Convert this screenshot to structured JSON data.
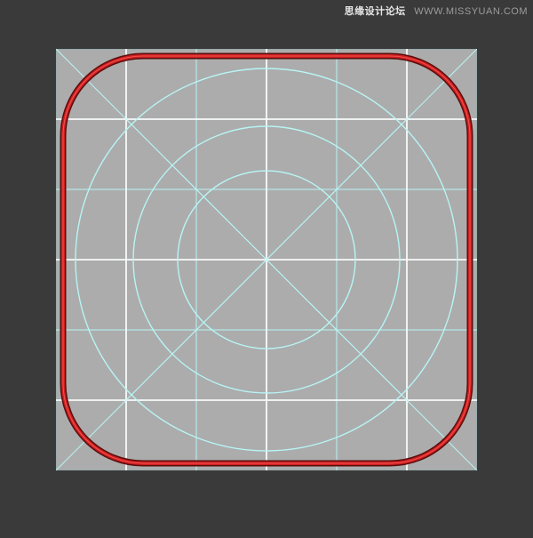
{
  "watermark": {
    "brand": "思缘设计论坛",
    "url_label": "WWW.MISSYUAN.COM"
  },
  "canvas": {
    "background": "#3a3a3a",
    "artboard_fill": "#acacac",
    "guide_stroke": "#b8f4f4",
    "guide_highlight": "#ffffff",
    "path_stroke": "#d01e1e",
    "path_shadow": "#5a0e0e",
    "artboard_size": 474,
    "grid_divisions": [
      79,
      158,
      237,
      316,
      395
    ],
    "circle_radii": [
      100,
      150,
      215
    ],
    "squircle_inset": 8,
    "squircle_corner": 90
  }
}
